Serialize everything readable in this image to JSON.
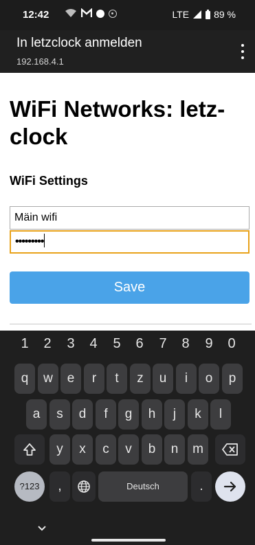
{
  "status_bar": {
    "time": "12:42",
    "network": "LTE",
    "battery": "89 %"
  },
  "app_bar": {
    "title": "In letzclock anmelden",
    "subtitle": "192.168.4.1"
  },
  "page": {
    "title": "WiFi Networks: letz-clock",
    "section_title": "WiFi Settings",
    "ssid_value": "Mäin wifi",
    "password_value": "•••••••••",
    "save_label": "Save"
  },
  "keyboard": {
    "number_row": [
      "1",
      "2",
      "3",
      "4",
      "5",
      "6",
      "7",
      "8",
      "9",
      "0"
    ],
    "row1": [
      "q",
      "w",
      "e",
      "r",
      "t",
      "z",
      "u",
      "i",
      "o",
      "p"
    ],
    "row2": [
      "a",
      "s",
      "d",
      "f",
      "g",
      "h",
      "j",
      "k",
      "l"
    ],
    "row3": [
      "y",
      "x",
      "c",
      "v",
      "b",
      "n",
      "m"
    ],
    "symbols_label": "?123",
    "comma": ",",
    "space_label": "Deutsch",
    "period": "."
  }
}
